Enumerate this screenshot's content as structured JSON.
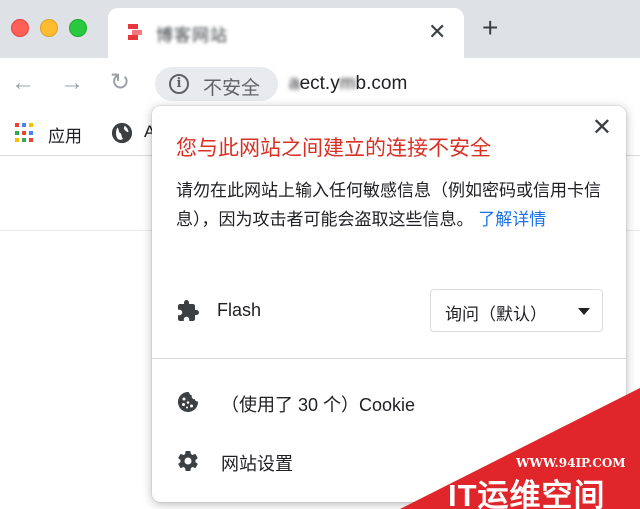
{
  "tab": {
    "title": "博客网站",
    "close": "✕",
    "new_tab": "+"
  },
  "toolbar": {
    "back": "←",
    "forward": "→",
    "reload": "↻",
    "security_label": "不安全",
    "url_prefix": "a",
    "url_blurred": "ect.y",
    "url_mid": "m",
    "url_suffix": "b.com"
  },
  "bookmarks": {
    "apps_label": "应用",
    "second_label": "A"
  },
  "popup": {
    "close": "✕",
    "title": "您与此网站之间建立的连接不安全",
    "description": "请勿在此网站上输入任何敏感信息（例如密码或信用卡信息），因为攻击者可能会盗取这些信息。",
    "learn_more": "了解详情",
    "flash_label": "Flash",
    "flash_value": "询问（默认）",
    "cookie_label": "（使用了 30 个）Cookie",
    "site_settings_label": "网站设置"
  },
  "watermark": {
    "url": "WWW.94IP.COM",
    "brand": "IT运维空间"
  },
  "colors": {
    "danger": "#d93025",
    "link": "#1a73e8",
    "watermark": "#e0262a"
  }
}
